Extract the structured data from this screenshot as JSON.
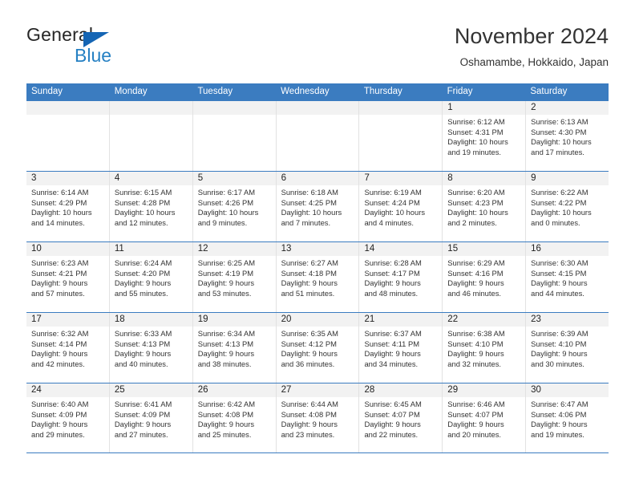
{
  "brand": {
    "name_top": "General",
    "name_bottom": "Blue",
    "accent_color": "#2580c3",
    "triangle_color": "#1565b4"
  },
  "header": {
    "title": "November 2024",
    "subtitle": "Oshamambe, Hokkaido, Japan"
  },
  "calendar": {
    "header_color": "#3b7cc0",
    "weekdays": [
      "Sunday",
      "Monday",
      "Tuesday",
      "Wednesday",
      "Thursday",
      "Friday",
      "Saturday"
    ],
    "weeks": [
      [
        {
          "empty": true
        },
        {
          "empty": true
        },
        {
          "empty": true
        },
        {
          "empty": true
        },
        {
          "empty": true
        },
        {
          "day": "1",
          "sunrise": "Sunrise: 6:12 AM",
          "sunset": "Sunset: 4:31 PM",
          "daylight_1": "Daylight: 10 hours",
          "daylight_2": "and 19 minutes."
        },
        {
          "day": "2",
          "sunrise": "Sunrise: 6:13 AM",
          "sunset": "Sunset: 4:30 PM",
          "daylight_1": "Daylight: 10 hours",
          "daylight_2": "and 17 minutes."
        }
      ],
      [
        {
          "day": "3",
          "sunrise": "Sunrise: 6:14 AM",
          "sunset": "Sunset: 4:29 PM",
          "daylight_1": "Daylight: 10 hours",
          "daylight_2": "and 14 minutes."
        },
        {
          "day": "4",
          "sunrise": "Sunrise: 6:15 AM",
          "sunset": "Sunset: 4:28 PM",
          "daylight_1": "Daylight: 10 hours",
          "daylight_2": "and 12 minutes."
        },
        {
          "day": "5",
          "sunrise": "Sunrise: 6:17 AM",
          "sunset": "Sunset: 4:26 PM",
          "daylight_1": "Daylight: 10 hours",
          "daylight_2": "and 9 minutes."
        },
        {
          "day": "6",
          "sunrise": "Sunrise: 6:18 AM",
          "sunset": "Sunset: 4:25 PM",
          "daylight_1": "Daylight: 10 hours",
          "daylight_2": "and 7 minutes."
        },
        {
          "day": "7",
          "sunrise": "Sunrise: 6:19 AM",
          "sunset": "Sunset: 4:24 PM",
          "daylight_1": "Daylight: 10 hours",
          "daylight_2": "and 4 minutes."
        },
        {
          "day": "8",
          "sunrise": "Sunrise: 6:20 AM",
          "sunset": "Sunset: 4:23 PM",
          "daylight_1": "Daylight: 10 hours",
          "daylight_2": "and 2 minutes."
        },
        {
          "day": "9",
          "sunrise": "Sunrise: 6:22 AM",
          "sunset": "Sunset: 4:22 PM",
          "daylight_1": "Daylight: 10 hours",
          "daylight_2": "and 0 minutes."
        }
      ],
      [
        {
          "day": "10",
          "sunrise": "Sunrise: 6:23 AM",
          "sunset": "Sunset: 4:21 PM",
          "daylight_1": "Daylight: 9 hours",
          "daylight_2": "and 57 minutes."
        },
        {
          "day": "11",
          "sunrise": "Sunrise: 6:24 AM",
          "sunset": "Sunset: 4:20 PM",
          "daylight_1": "Daylight: 9 hours",
          "daylight_2": "and 55 minutes."
        },
        {
          "day": "12",
          "sunrise": "Sunrise: 6:25 AM",
          "sunset": "Sunset: 4:19 PM",
          "daylight_1": "Daylight: 9 hours",
          "daylight_2": "and 53 minutes."
        },
        {
          "day": "13",
          "sunrise": "Sunrise: 6:27 AM",
          "sunset": "Sunset: 4:18 PM",
          "daylight_1": "Daylight: 9 hours",
          "daylight_2": "and 51 minutes."
        },
        {
          "day": "14",
          "sunrise": "Sunrise: 6:28 AM",
          "sunset": "Sunset: 4:17 PM",
          "daylight_1": "Daylight: 9 hours",
          "daylight_2": "and 48 minutes."
        },
        {
          "day": "15",
          "sunrise": "Sunrise: 6:29 AM",
          "sunset": "Sunset: 4:16 PM",
          "daylight_1": "Daylight: 9 hours",
          "daylight_2": "and 46 minutes."
        },
        {
          "day": "16",
          "sunrise": "Sunrise: 6:30 AM",
          "sunset": "Sunset: 4:15 PM",
          "daylight_1": "Daylight: 9 hours",
          "daylight_2": "and 44 minutes."
        }
      ],
      [
        {
          "day": "17",
          "sunrise": "Sunrise: 6:32 AM",
          "sunset": "Sunset: 4:14 PM",
          "daylight_1": "Daylight: 9 hours",
          "daylight_2": "and 42 minutes."
        },
        {
          "day": "18",
          "sunrise": "Sunrise: 6:33 AM",
          "sunset": "Sunset: 4:13 PM",
          "daylight_1": "Daylight: 9 hours",
          "daylight_2": "and 40 minutes."
        },
        {
          "day": "19",
          "sunrise": "Sunrise: 6:34 AM",
          "sunset": "Sunset: 4:13 PM",
          "daylight_1": "Daylight: 9 hours",
          "daylight_2": "and 38 minutes."
        },
        {
          "day": "20",
          "sunrise": "Sunrise: 6:35 AM",
          "sunset": "Sunset: 4:12 PM",
          "daylight_1": "Daylight: 9 hours",
          "daylight_2": "and 36 minutes."
        },
        {
          "day": "21",
          "sunrise": "Sunrise: 6:37 AM",
          "sunset": "Sunset: 4:11 PM",
          "daylight_1": "Daylight: 9 hours",
          "daylight_2": "and 34 minutes."
        },
        {
          "day": "22",
          "sunrise": "Sunrise: 6:38 AM",
          "sunset": "Sunset: 4:10 PM",
          "daylight_1": "Daylight: 9 hours",
          "daylight_2": "and 32 minutes."
        },
        {
          "day": "23",
          "sunrise": "Sunrise: 6:39 AM",
          "sunset": "Sunset: 4:10 PM",
          "daylight_1": "Daylight: 9 hours",
          "daylight_2": "and 30 minutes."
        }
      ],
      [
        {
          "day": "24",
          "sunrise": "Sunrise: 6:40 AM",
          "sunset": "Sunset: 4:09 PM",
          "daylight_1": "Daylight: 9 hours",
          "daylight_2": "and 29 minutes."
        },
        {
          "day": "25",
          "sunrise": "Sunrise: 6:41 AM",
          "sunset": "Sunset: 4:09 PM",
          "daylight_1": "Daylight: 9 hours",
          "daylight_2": "and 27 minutes."
        },
        {
          "day": "26",
          "sunrise": "Sunrise: 6:42 AM",
          "sunset": "Sunset: 4:08 PM",
          "daylight_1": "Daylight: 9 hours",
          "daylight_2": "and 25 minutes."
        },
        {
          "day": "27",
          "sunrise": "Sunrise: 6:44 AM",
          "sunset": "Sunset: 4:08 PM",
          "daylight_1": "Daylight: 9 hours",
          "daylight_2": "and 23 minutes."
        },
        {
          "day": "28",
          "sunrise": "Sunrise: 6:45 AM",
          "sunset": "Sunset: 4:07 PM",
          "daylight_1": "Daylight: 9 hours",
          "daylight_2": "and 22 minutes."
        },
        {
          "day": "29",
          "sunrise": "Sunrise: 6:46 AM",
          "sunset": "Sunset: 4:07 PM",
          "daylight_1": "Daylight: 9 hours",
          "daylight_2": "and 20 minutes."
        },
        {
          "day": "30",
          "sunrise": "Sunrise: 6:47 AM",
          "sunset": "Sunset: 4:06 PM",
          "daylight_1": "Daylight: 9 hours",
          "daylight_2": "and 19 minutes."
        }
      ]
    ]
  }
}
